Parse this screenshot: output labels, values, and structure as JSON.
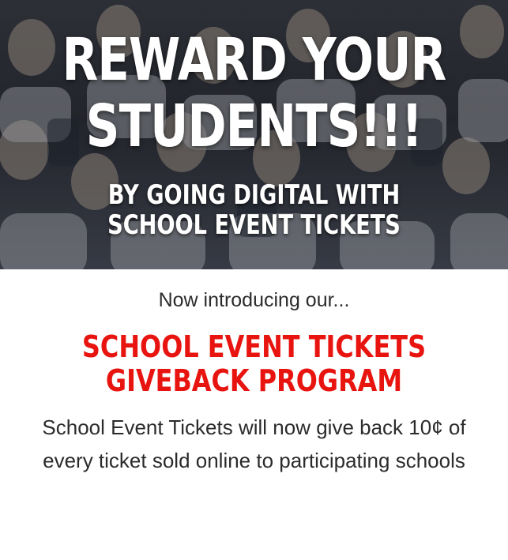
{
  "hero": {
    "headline_line1": "REWARD YOUR",
    "headline_line2": "STUDENTS!!!",
    "subheadline_line1": "BY GOING DIGITAL WITH",
    "subheadline_line2": "SCHOOL EVENT TICKETS",
    "image": "crowd-of-cheering-students-photo"
  },
  "intro": {
    "text": "Now introducing our..."
  },
  "program": {
    "title_line1": "SCHOOL EVENT TICKETS",
    "title_line2": "GIVEBACK PROGRAM",
    "color": "#e8140f"
  },
  "description": {
    "line1": "School Event Tickets will now give back 10¢ of",
    "line2": "every ticket sold online to participating schools"
  },
  "colors": {
    "accent_red": "#e8140f",
    "body_text": "#2b2b2b",
    "hero_text": "#ffffff"
  }
}
